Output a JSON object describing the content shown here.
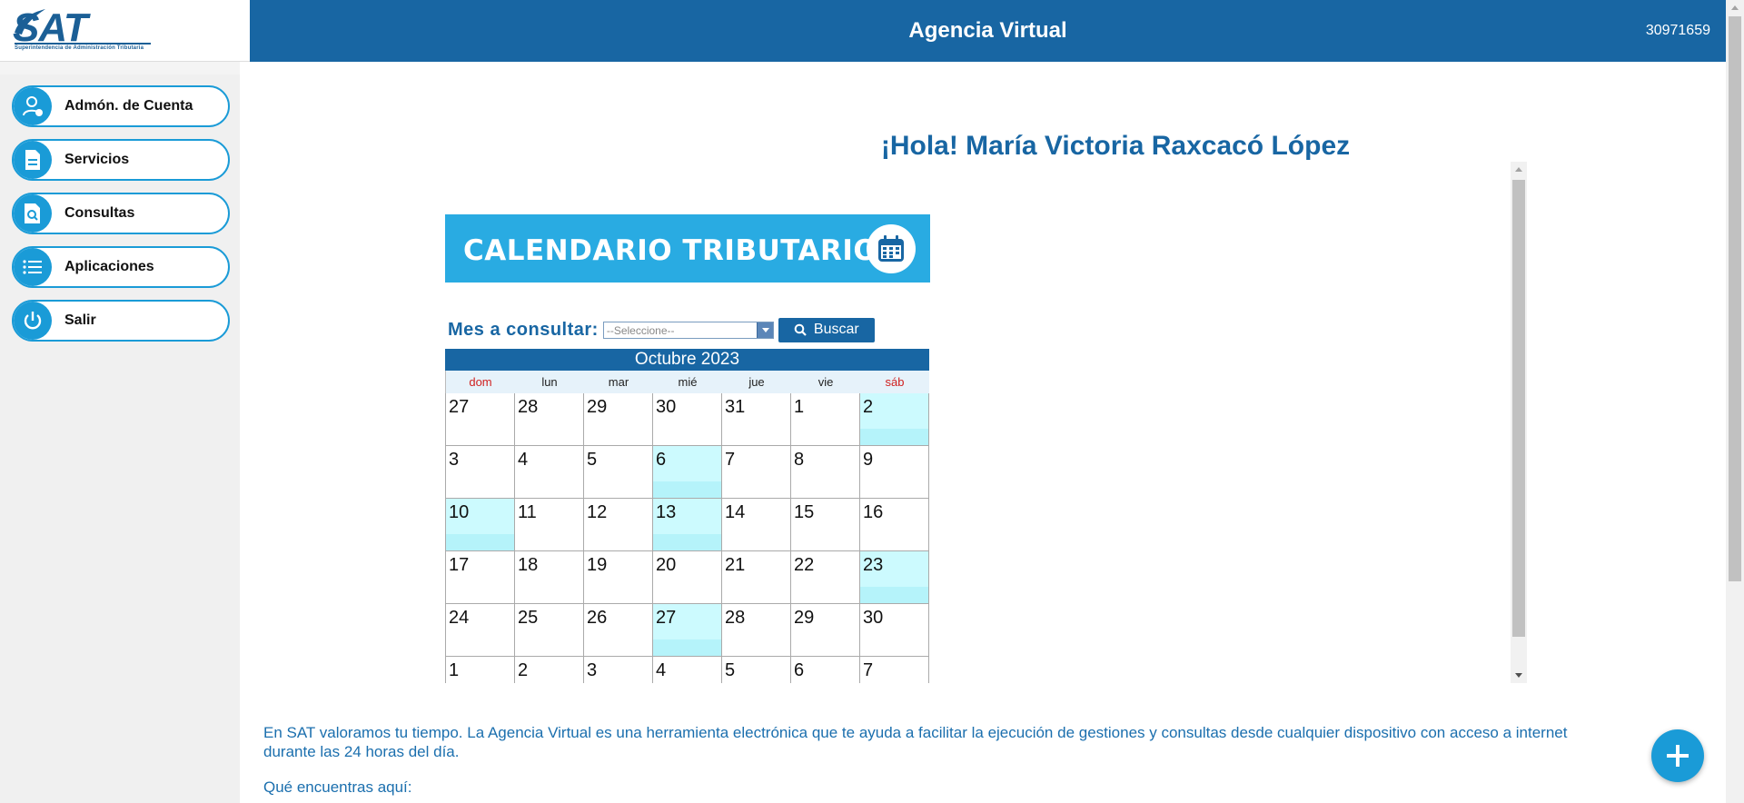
{
  "header": {
    "logo_text": "SAT",
    "logo_subtitle": "Superintendencia de Administración Tributaria",
    "title": "Agencia Virtual",
    "user_id": "30971659"
  },
  "sidebar": {
    "items": [
      {
        "label": "Admón. de Cuenta",
        "icon": "user-settings-icon"
      },
      {
        "label": "Servicios",
        "icon": "document-icon"
      },
      {
        "label": "Consultas",
        "icon": "search-document-icon"
      },
      {
        "label": "Aplicaciones",
        "icon": "list-icon"
      },
      {
        "label": "Salir",
        "icon": "power-icon"
      }
    ]
  },
  "main": {
    "greeting": "¡Hola! María Victoria Raxcacó López",
    "banner_text": "CALENDARIO TRIBUTARIO",
    "search": {
      "label": "Mes a consultar:",
      "select_value": "--Seleccione--",
      "button_label": "Buscar"
    },
    "calendar": {
      "month_title": "Octubre 2023",
      "weekdays": [
        "dom",
        "lun",
        "mar",
        "mié",
        "jue",
        "vie",
        "sáb"
      ],
      "weeks": [
        [
          {
            "d": "27"
          },
          {
            "d": "28"
          },
          {
            "d": "29"
          },
          {
            "d": "30"
          },
          {
            "d": "31"
          },
          {
            "d": "1"
          },
          {
            "d": "2",
            "hl": true
          }
        ],
        [
          {
            "d": "3"
          },
          {
            "d": "4"
          },
          {
            "d": "5"
          },
          {
            "d": "6",
            "hl": true
          },
          {
            "d": "7"
          },
          {
            "d": "8"
          },
          {
            "d": "9"
          }
        ],
        [
          {
            "d": "10",
            "hl": true
          },
          {
            "d": "11"
          },
          {
            "d": "12"
          },
          {
            "d": "13",
            "hl": true
          },
          {
            "d": "14"
          },
          {
            "d": "15"
          },
          {
            "d": "16"
          }
        ],
        [
          {
            "d": "17"
          },
          {
            "d": "18"
          },
          {
            "d": "19"
          },
          {
            "d": "20"
          },
          {
            "d": "21"
          },
          {
            "d": "22"
          },
          {
            "d": "23",
            "hl": true
          }
        ],
        [
          {
            "d": "24"
          },
          {
            "d": "25"
          },
          {
            "d": "26"
          },
          {
            "d": "27",
            "hl": true
          },
          {
            "d": "28"
          },
          {
            "d": "29"
          },
          {
            "d": "30"
          }
        ],
        [
          {
            "d": "1"
          },
          {
            "d": "2"
          },
          {
            "d": "3"
          },
          {
            "d": "4"
          },
          {
            "d": "5"
          },
          {
            "d": "6"
          },
          {
            "d": "7"
          }
        ]
      ]
    },
    "description": "En SAT valoramos tu tiempo. La Agencia Virtual es una herramienta electrónica que te ayuda a facilitar la ejecución de gestiones y consultas desde cualquier dispositivo con acceso a internet durante las 24 horas del día.",
    "section_heading": "Qué encuentras aquí:"
  },
  "colors": {
    "primary": "#1866a3",
    "accent": "#1a9bd7",
    "banner": "#29abe2",
    "highlight": "#ccfafe",
    "weekend": "#d02020"
  },
  "fab_icon": "plus-icon"
}
